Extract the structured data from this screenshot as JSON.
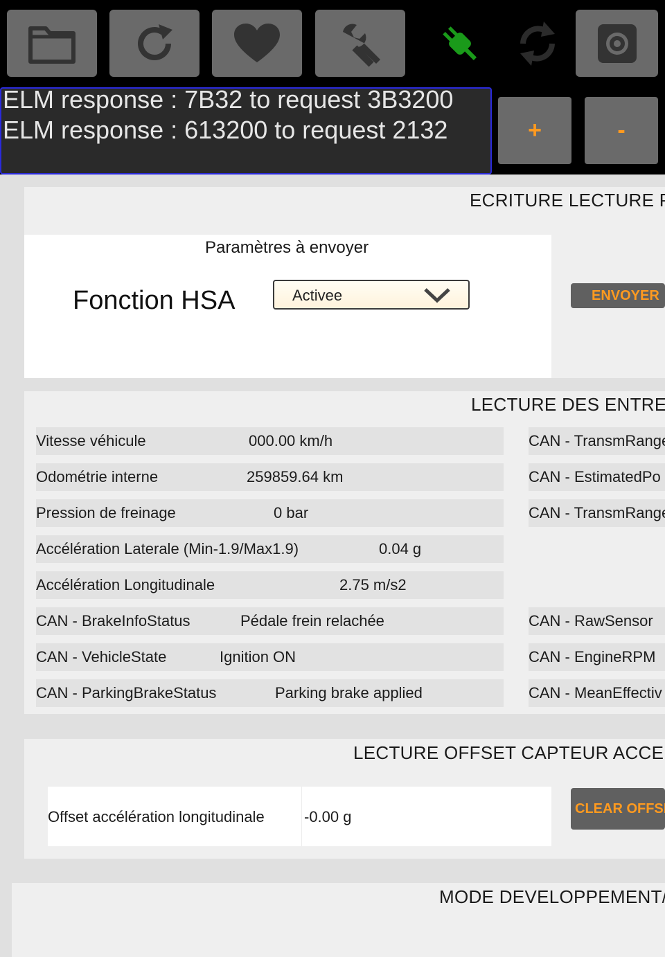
{
  "toolbar": {
    "buttons": [
      {
        "icon": "folder-icon"
      },
      {
        "icon": "refresh-icon"
      },
      {
        "icon": "heart-icon"
      },
      {
        "icon": "wrench-icon"
      },
      {
        "icon": "plug-icon",
        "color": "#1a9a1a"
      },
      {
        "icon": "sync-icon"
      },
      {
        "icon": "gear-icon"
      }
    ]
  },
  "response": {
    "lines": [
      "ELM response : 7B32 to request 3B3200",
      "ELM response : 613200 to request 2132"
    ],
    "plus_label": "+",
    "minus_label": "-"
  },
  "ecriture": {
    "title": "ECRITURE LECTURE PA",
    "params_title": "Paramètres à envoyer",
    "function_label": "Fonction HSA",
    "dropdown_value": "Activee",
    "send_label": "ENVOYER"
  },
  "lecture": {
    "title": "LECTURE DES ENTREE",
    "left_rows": [
      {
        "label": "Vitesse véhicule",
        "value": "000.00 km/h"
      },
      {
        "label": "Odométrie interne",
        "value": "259859.64 km"
      },
      {
        "label": "Pression de freinage",
        "value": "0 bar"
      },
      {
        "label": "Accélération Laterale (Min-1.9/Max1.9)",
        "value": "0.04 g"
      },
      {
        "label": "Accélération Longitudinale",
        "value": "2.75 m/s2"
      },
      {
        "label": "CAN - BrakeInfoStatus",
        "value": "Pédale frein relachée"
      },
      {
        "label": "CAN - VehicleState",
        "value": "Ignition ON"
      },
      {
        "label": "CAN - ParkingBrakeStatus",
        "value": "Parking brake applied"
      }
    ],
    "right_rows": [
      {
        "label": "CAN - TransmRange"
      },
      {
        "label": "CAN - EstimatedPo"
      },
      {
        "label": "CAN - TransmRange"
      },
      {
        "label": "CAN - RawSensor"
      },
      {
        "label": "CAN - EngineRPM"
      },
      {
        "label": "CAN - MeanEffectiv"
      }
    ]
  },
  "offset": {
    "title": "LECTURE OFFSET CAPTEUR ACCELE",
    "label": "Offset accélération longitudinale",
    "value": "-0.00 g",
    "clear_label": "CLEAR OFFSE"
  },
  "dev": {
    "title": "MODE DEVELOPPEMENT/"
  },
  "colors": {
    "accent": "#ff9a1f",
    "toolbar_bg": "#000000",
    "button_gray": "#6a6a6a",
    "plug_green": "#1a9a1a",
    "response_border": "#2a2adc"
  }
}
